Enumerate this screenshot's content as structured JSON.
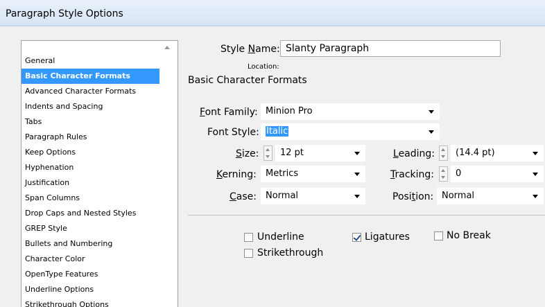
{
  "window": {
    "title": "Paragraph Style Options"
  },
  "sidebar": {
    "items": [
      {
        "label": "General",
        "selected": false
      },
      {
        "label": "Basic Character Formats",
        "selected": true
      },
      {
        "label": "Advanced Character Formats",
        "selected": false
      },
      {
        "label": "Indents and Spacing",
        "selected": false
      },
      {
        "label": "Tabs",
        "selected": false
      },
      {
        "label": "Paragraph Rules",
        "selected": false
      },
      {
        "label": "Keep Options",
        "selected": false
      },
      {
        "label": "Hyphenation",
        "selected": false
      },
      {
        "label": "Justification",
        "selected": false
      },
      {
        "label": "Span Columns",
        "selected": false
      },
      {
        "label": "Drop Caps and Nested Styles",
        "selected": false
      },
      {
        "label": "GREP Style",
        "selected": false
      },
      {
        "label": "Bullets and Numbering",
        "selected": false
      },
      {
        "label": "Character Color",
        "selected": false
      },
      {
        "label": "OpenType Features",
        "selected": false
      },
      {
        "label": "Underline Options",
        "selected": false
      },
      {
        "label": "Strikethrough Options",
        "selected": false
      }
    ]
  },
  "style_name": {
    "label_pre": "Style ",
    "label_key": "N",
    "label_post": "ame:",
    "value": "Slanty Paragraph"
  },
  "location": {
    "label": "Location:"
  },
  "section_title": "Basic Character Formats",
  "font_family": {
    "label_key": "F",
    "label_post": "ont Family:",
    "value": "Minion Pro"
  },
  "font_style": {
    "label": "Font Style:",
    "value": "Italic"
  },
  "size": {
    "label_key": "S",
    "label_post": "ize:",
    "value": "12 pt"
  },
  "leading": {
    "label_key": "L",
    "label_post": "eading:",
    "value": "(14.4 pt)"
  },
  "kerning": {
    "label_key": "K",
    "label_post": "erning:",
    "value": "Metrics"
  },
  "tracking": {
    "label_key": "T",
    "label_post": "racking:",
    "value": "0"
  },
  "case": {
    "label_key": "C",
    "label_post": "ase:",
    "value": "Normal"
  },
  "position": {
    "label_pre": "Posi",
    "label_key": "t",
    "label_post": "ion:",
    "value": "Normal"
  },
  "checkboxes": {
    "underline": {
      "label": "Underline",
      "checked": false
    },
    "ligatures": {
      "label": "Ligatures",
      "checked": true
    },
    "no_break": {
      "label": "No Break",
      "checked": false
    },
    "strikethrough": {
      "label": "Strikethrough",
      "checked": false
    }
  },
  "colors": {
    "selection": "#3399ff",
    "dialog_bg": "#f0f0f0"
  }
}
